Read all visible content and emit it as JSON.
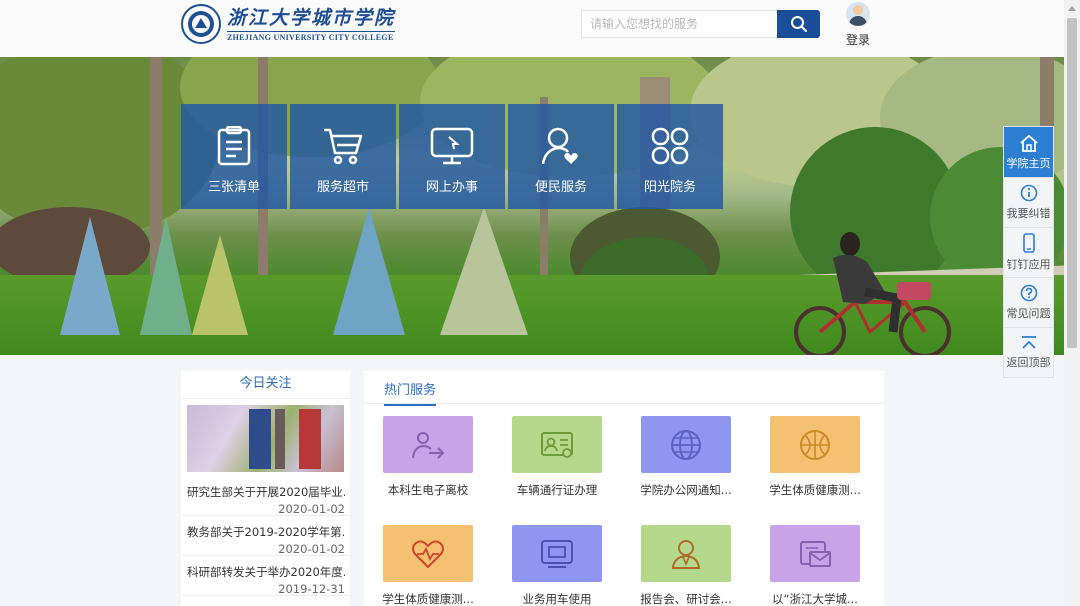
{
  "header": {
    "logo_cn": "浙江大学城市学院",
    "logo_en": "ZHEJIANG UNIVERSITY CITY COLLEGE",
    "search_placeholder": "请输入您想找的服务",
    "login_label": "登录"
  },
  "tiles": [
    {
      "label": "三张清单",
      "icon": "clipboard-icon"
    },
    {
      "label": "服务超市",
      "icon": "cart-icon"
    },
    {
      "label": "网上办事",
      "icon": "monitor-icon"
    },
    {
      "label": "便民服务",
      "icon": "user-heart-icon"
    },
    {
      "label": "阳光院务",
      "icon": "clover-icon"
    }
  ],
  "float_nav": [
    {
      "label": "学院主页",
      "icon": "home-icon"
    },
    {
      "label": "我要纠错",
      "icon": "info-icon"
    },
    {
      "label": "钉钉应用",
      "icon": "phone-icon"
    },
    {
      "label": "常见问题",
      "icon": "question-icon"
    },
    {
      "label": "返回顶部",
      "icon": "back-to-top-icon"
    }
  ],
  "today": {
    "title": "今日关注",
    "news": [
      {
        "title": "研究生部关于开展2020届毕业...",
        "date": "2020-01-02"
      },
      {
        "title": "教务部关于2019-2020学年第...",
        "date": "2020-01-02"
      },
      {
        "title": "科研部转发关于举办2020年度...",
        "date": "2019-12-31"
      }
    ]
  },
  "hot": {
    "title": "热门服务",
    "services": [
      {
        "label": "本科生电子离校",
        "icon": "exit-icon",
        "color": "#c9a3e8"
      },
      {
        "label": "车辆通行证办理",
        "icon": "id-card-icon",
        "color": "#b5d98a"
      },
      {
        "label": "学院办公网通知...",
        "icon": "globe-icon",
        "color": "#8e96f0"
      },
      {
        "label": "学生体质健康测...",
        "icon": "basketball-icon",
        "color": "#f4c071"
      },
      {
        "label": "学生体质健康测...",
        "icon": "heart-pulse-icon",
        "color": "#f4c071"
      },
      {
        "label": "业务用车使用",
        "icon": "monitor-box-icon",
        "color": "#8e96f0"
      },
      {
        "label": "报告会、研讨会...",
        "icon": "person-icon",
        "color": "#b5d98a"
      },
      {
        "label": "以“浙江大学城...",
        "icon": "mail-icon",
        "color": "#c9a3e8"
      }
    ]
  },
  "colors": {
    "brand": "#1e4f94",
    "tile_bg": "#2158a3",
    "accent": "#2a6cc2"
  }
}
